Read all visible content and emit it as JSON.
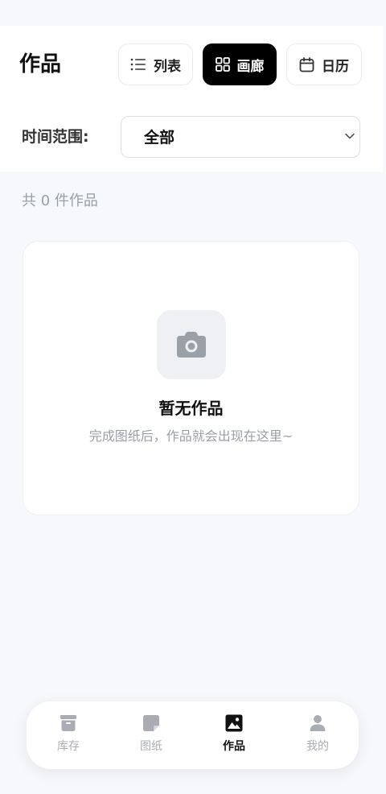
{
  "header": {
    "title": "作品",
    "view_buttons": {
      "list": "列表",
      "gallery": "画廊",
      "calendar": "日历",
      "active": "gallery"
    }
  },
  "filter": {
    "label": "时间范围:",
    "selected": "全部"
  },
  "summary": {
    "count_text": "共 0 件作品"
  },
  "empty_state": {
    "icon": "camera-icon",
    "title": "暂无作品",
    "subtitle": "完成图纸后，作品就会出现在这里~"
  },
  "tabbar": {
    "items": [
      {
        "label": "库存",
        "icon": "box-icon"
      },
      {
        "label": "图纸",
        "icon": "note-icon"
      },
      {
        "label": "作品",
        "icon": "image-icon"
      },
      {
        "label": "我的",
        "icon": "person-icon"
      }
    ],
    "active": "作品"
  },
  "colors": {
    "accent": "#000000",
    "background": "#f7f8fb",
    "muted_text": "#9a9ea6",
    "inactive_icon": "#a9adb3"
  }
}
